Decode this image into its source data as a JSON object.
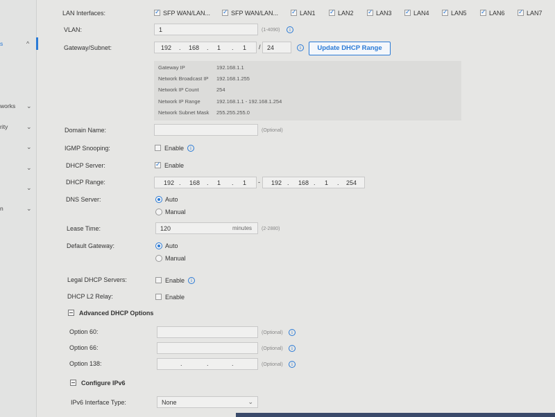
{
  "sidebar": {
    "items": [
      {
        "label": "s",
        "icon": "chevron-up-icon",
        "chev": "^"
      },
      {
        "label": "works",
        "icon": "chevron-down-icon",
        "chev": "⌄"
      },
      {
        "label": "rity",
        "icon": "chevron-down-icon",
        "chev": "⌄"
      },
      {
        "label": "",
        "icon": "chevron-down-icon",
        "chev": "⌄"
      },
      {
        "label": "",
        "icon": "chevron-down-icon",
        "chev": "⌄"
      },
      {
        "label": "",
        "icon": "chevron-down-icon",
        "chev": "⌄"
      },
      {
        "label": "n",
        "icon": "chevron-down-icon",
        "chev": "⌄"
      }
    ]
  },
  "form": {
    "lan_interfaces_label": "LAN Interfaces:",
    "lan_interfaces": [
      {
        "label": "SFP WAN/LAN...",
        "checked": true
      },
      {
        "label": "SFP WAN/LAN...",
        "checked": true
      },
      {
        "label": "LAN1",
        "checked": true
      },
      {
        "label": "LAN2",
        "checked": true
      },
      {
        "label": "LAN3",
        "checked": true
      },
      {
        "label": "LAN4",
        "checked": true
      },
      {
        "label": "LAN5",
        "checked": true
      },
      {
        "label": "LAN6",
        "checked": true
      },
      {
        "label": "LAN7",
        "checked": true
      }
    ],
    "vlan_label": "VLAN:",
    "vlan_value": "1",
    "vlan_hint": "(1-4090)",
    "gateway_label": "Gateway/Subnet:",
    "gateway_ip": [
      "192",
      "168",
      "1",
      "1"
    ],
    "gateway_mask": "24",
    "update_button": "Update DHCP Range",
    "info_panel": [
      {
        "k": "Gateway IP",
        "v": "192.168.1.1"
      },
      {
        "k": "Network Broadcast IP",
        "v": "192.168.1.255"
      },
      {
        "k": "Network IP Count",
        "v": "254"
      },
      {
        "k": "Network IP Range",
        "v": "192.168.1.1 - 192.168.1.254"
      },
      {
        "k": "Network Subnet Mask",
        "v": "255.255.255.0"
      }
    ],
    "domain_label": "Domain Name:",
    "domain_value": "",
    "domain_hint": "(Optional)",
    "igmp_label": "IGMP Snooping:",
    "igmp_enable": "Enable",
    "dhcp_server_label": "DHCP Server:",
    "dhcp_server_enable": "Enable",
    "dhcp_range_label": "DHCP Range:",
    "dhcp_range_start": [
      "192",
      "168",
      "1",
      "1"
    ],
    "dhcp_range_end": [
      "192",
      "168",
      "1",
      "254"
    ],
    "range_sep": "-",
    "dns_label": "DNS Server:",
    "dns_auto": "Auto",
    "dns_manual": "Manual",
    "lease_label": "Lease Time:",
    "lease_value": "120",
    "lease_unit": "minutes",
    "lease_hint": "(2-2880)",
    "default_gw_label": "Default Gateway:",
    "gw_auto": "Auto",
    "gw_manual": "Manual",
    "legal_dhcp_label": "Legal DHCP Servers:",
    "legal_dhcp_enable": "Enable",
    "dhcp_l2_label": "DHCP L2 Relay:",
    "dhcp_l2_enable": "Enable",
    "advanced_title": "Advanced DHCP Options",
    "option60_label": "Option 60:",
    "option66_label": "Option 66:",
    "option138_label": "Option 138:",
    "optional_hint": "(Optional)",
    "ipv6_title": "Configure IPv6",
    "ipv6_type_label": "IPv6 Interface Type:",
    "ipv6_type_value": "None"
  }
}
